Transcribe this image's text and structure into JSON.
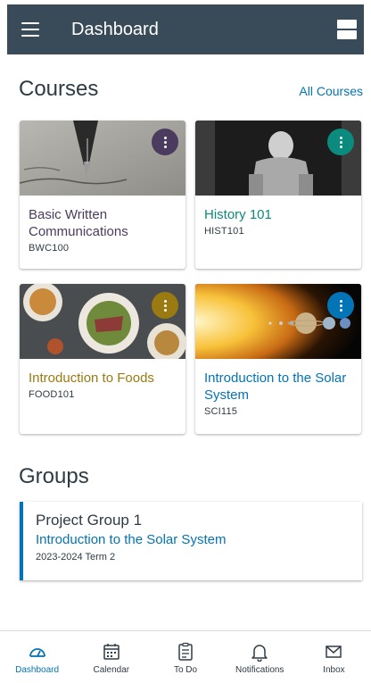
{
  "appbar": {
    "title": "Dashboard"
  },
  "courses_section": {
    "title": "Courses",
    "all_courses": "All Courses"
  },
  "courses": [
    {
      "name": "Basic Written Communications",
      "code": "BWC100",
      "color": "#4b3b5f",
      "kebab_color": "#4b3b5f",
      "image": "fountain-pen"
    },
    {
      "name": "History 101",
      "code": "HIST101",
      "color": "#0b8a7e",
      "kebab_color": "#0b8a7e",
      "image": "lincoln-memorial"
    },
    {
      "name": "Introduction to Foods",
      "code": "FOOD101",
      "color": "#9b7a12",
      "kebab_color": "#9b7a12",
      "image": "food-plates"
    },
    {
      "name": "Introduction to the Solar System",
      "code": "SCI115",
      "color": "#0374b5",
      "kebab_color": "#0374b5",
      "image": "solar-system"
    }
  ],
  "groups_section": {
    "title": "Groups"
  },
  "groups": [
    {
      "name": "Project Group 1",
      "course": "Introduction to the Solar System",
      "term": "2023-2024 Term 2"
    }
  ],
  "bottom_nav": [
    {
      "label": "Dashboard",
      "icon": "dashboard-icon",
      "active": true
    },
    {
      "label": "Calendar",
      "icon": "calendar-icon",
      "active": false
    },
    {
      "label": "To Do",
      "icon": "todo-clipboard-icon",
      "active": false
    },
    {
      "label": "Notifications",
      "icon": "bell-icon",
      "active": false
    },
    {
      "label": "Inbox",
      "icon": "envelope-icon",
      "active": false
    }
  ],
  "colors": {
    "appbar": "#394b58",
    "link": "#0374b5",
    "text": "#2d3b45"
  }
}
